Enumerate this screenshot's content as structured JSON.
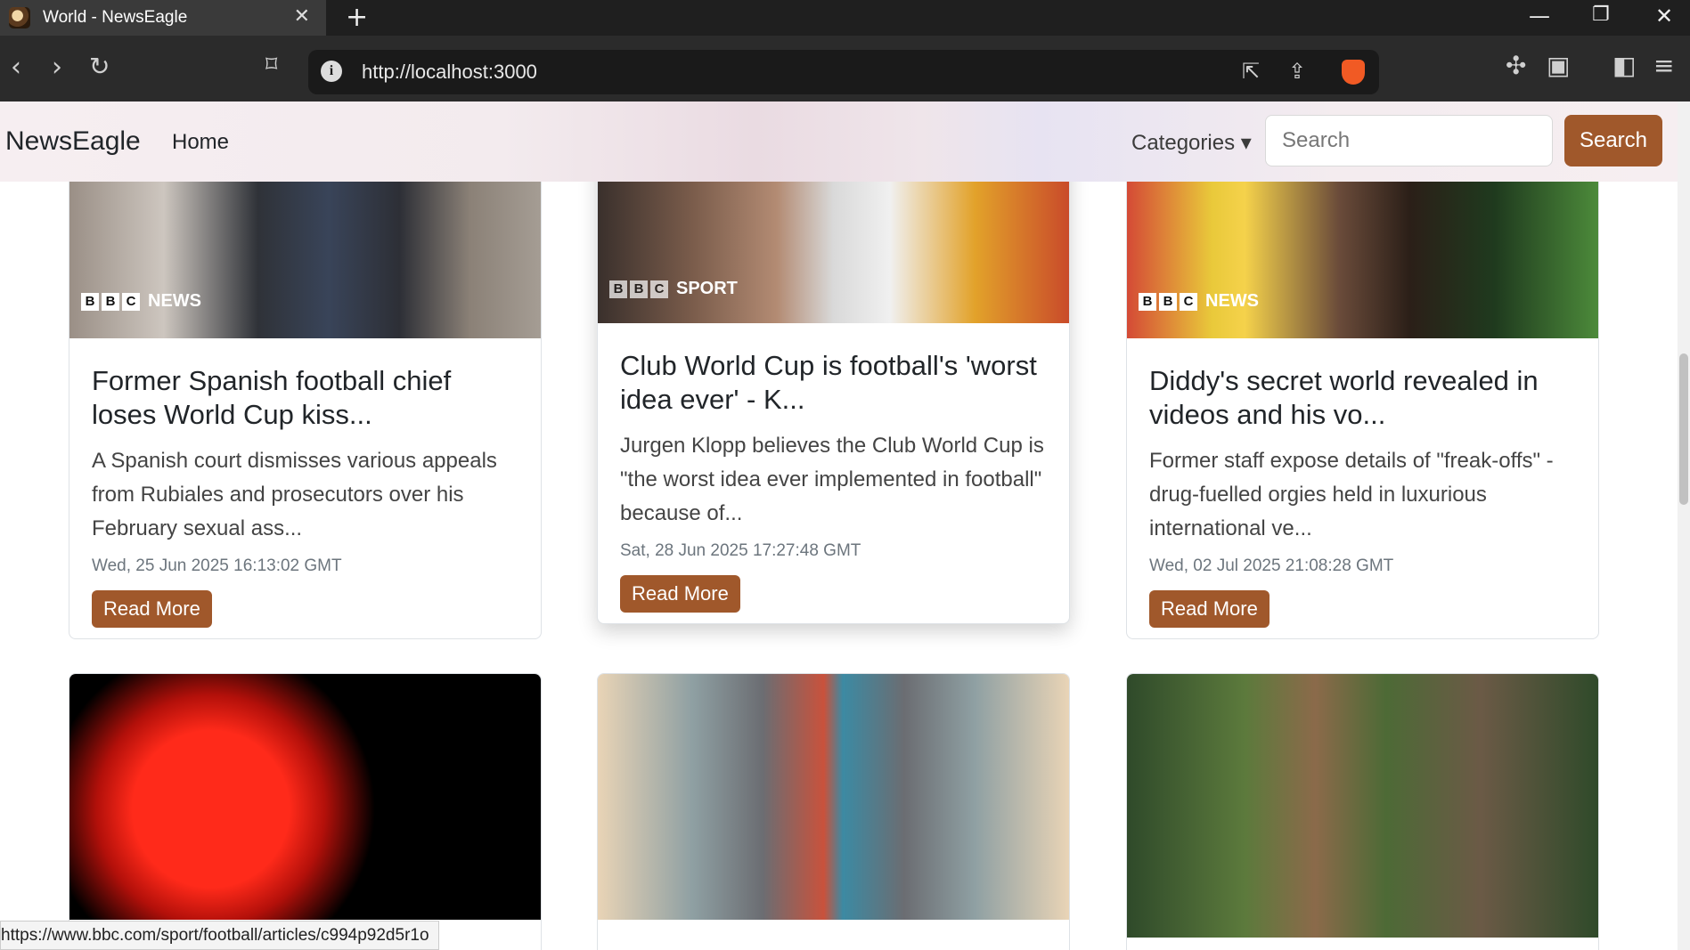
{
  "browser": {
    "tab_title": "World - NewsEagle",
    "tab_close": "✕",
    "new_tab": "+",
    "url": "http://localhost:3000",
    "status_url": "https://www.bbc.com/sport/football/articles/c994p92d5r1o"
  },
  "navbar": {
    "brand": "NewsEagle",
    "home": "Home",
    "categories": "Categories ▾",
    "search_placeholder": "Search",
    "search_button": "Search"
  },
  "cards": [
    {
      "badge": [
        "B",
        "B",
        "C"
      ],
      "badge_word": "NEWS",
      "title": "Former Spanish football chief loses World Cup kiss...",
      "text": "A Spanish court dismisses various appeals from Rubiales and prosecutors over his February sexual ass...",
      "date": "Wed, 25 Jun 2025 16:13:02 GMT",
      "button": "Read More"
    },
    {
      "badge": [
        "B",
        "B",
        "C"
      ],
      "badge_word": "SPORT",
      "title": "Club World Cup is football's 'worst idea ever' - K...",
      "text": "Jurgen Klopp believes the Club World Cup is \"the worst idea ever implemented in football\" because of...",
      "date": "Sat, 28 Jun 2025 17:27:48 GMT",
      "button": "Read More"
    },
    {
      "badge": [
        "B",
        "B",
        "C"
      ],
      "badge_word": "NEWS",
      "title": "Diddy's secret world revealed in videos and his vo...",
      "text": "Former staff expose details of \"freak-offs\" - drug-fuelled orgies held in luxurious international ve...",
      "date": "Wed, 02 Jul 2025 21:08:28 GMT",
      "button": "Read More"
    }
  ],
  "colors": {
    "accent": "#a0582b",
    "text": "#212529",
    "muted": "#6c757d"
  }
}
